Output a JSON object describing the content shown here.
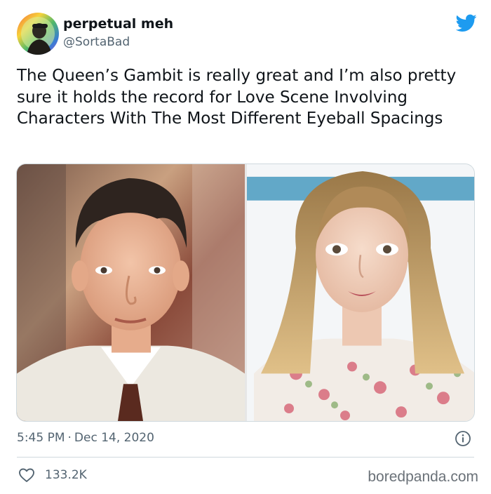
{
  "tweet": {
    "author": {
      "display_name": "perpetual meh",
      "handle": "@SortaBad"
    },
    "text": "The Queen’s Gambit is really great and I’m also pretty sure it holds the record for Love Scene Involving Characters With The Most Different Eyeball Spacings",
    "timestamp": {
      "time": "5:45 PM",
      "separator": "·",
      "date": "Dec 14, 2020"
    },
    "likes": "133.2K",
    "icons": {
      "brand": "twitter-bird-icon",
      "info": "info-icon",
      "like": "heart-icon"
    }
  },
  "watermark": "boredpanda.com",
  "colors": {
    "twitter_blue": "#1d9bf0",
    "text_primary": "#0f1419",
    "text_secondary": "#536471",
    "border": "#cfd9de"
  }
}
